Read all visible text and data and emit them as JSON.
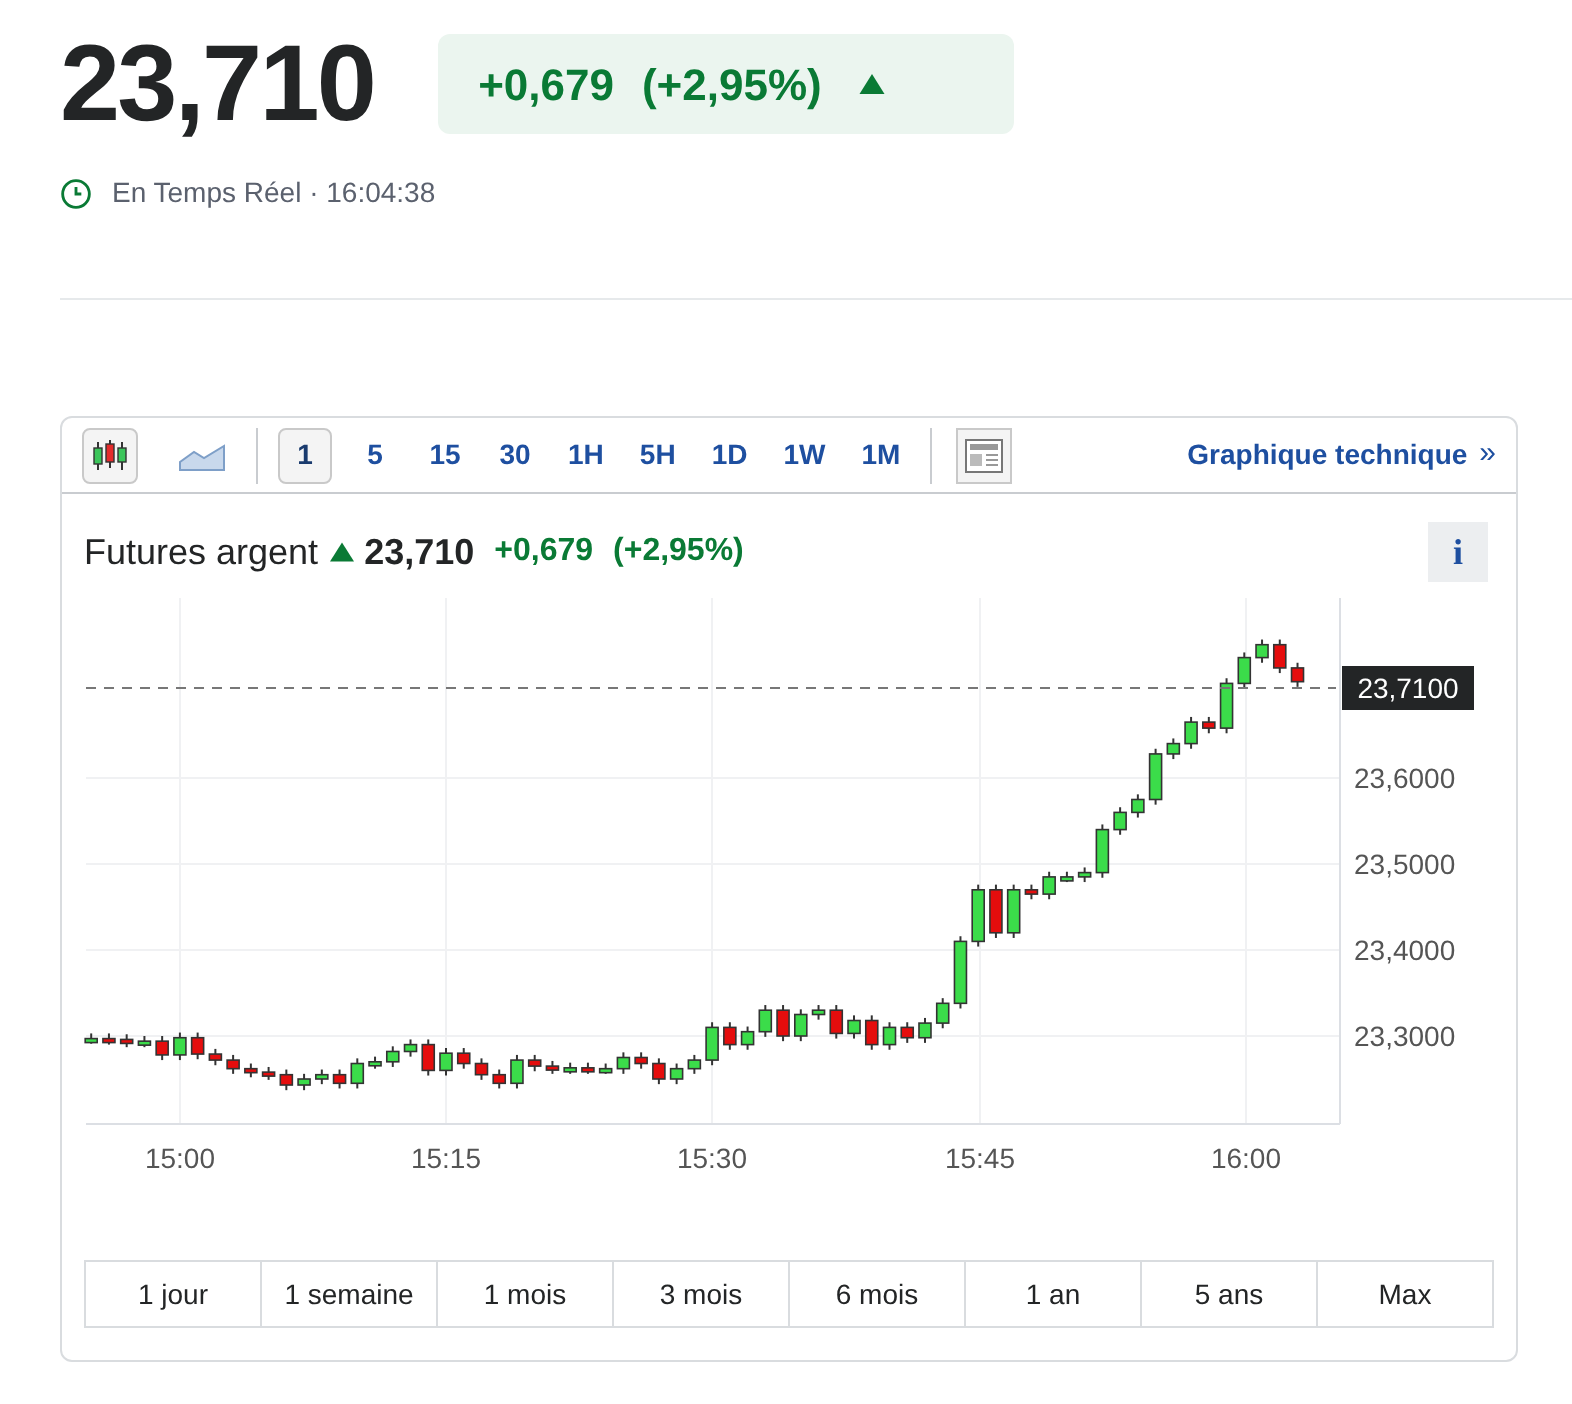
{
  "quote": {
    "price": "23,710",
    "change": "+0,679",
    "change_percent": "(+2,95%)",
    "trend_up": true,
    "status": "En Temps Réel · 16:04:38"
  },
  "chart_panel": {
    "chart_types": [
      {
        "kind": "candlestick",
        "selected": true
      },
      {
        "kind": "area",
        "selected": false
      }
    ],
    "intervals": [
      {
        "label": "1",
        "selected": true
      },
      {
        "label": "5",
        "selected": false
      },
      {
        "label": "15",
        "selected": false
      },
      {
        "label": "30",
        "selected": false
      },
      {
        "label": "1H",
        "selected": false
      },
      {
        "label": "5H",
        "selected": false
      },
      {
        "label": "1D",
        "selected": false
      },
      {
        "label": "1W",
        "selected": false
      },
      {
        "label": "1M",
        "selected": false
      }
    ],
    "technical_link": "Graphique technique",
    "link_arrow": "»",
    "instrument": "Futures argent",
    "price": "23,710",
    "change": "+0,679",
    "change_percent": "(+2,95%)",
    "trend_up": true,
    "info_button": "i",
    "x_axis_labels": [
      "15:00",
      "15:15",
      "15:30",
      "15:45",
      "16:00"
    ],
    "y_axis_labels": [
      "23,6000",
      "23,5000",
      "23,4000",
      "23,3000"
    ],
    "last_price_label": "23,7100",
    "ranges": [
      "1 jour",
      "1 semaine",
      "1 mois",
      "3 mois",
      "6 mois",
      "1 an",
      "5 ans",
      "Max"
    ]
  }
}
